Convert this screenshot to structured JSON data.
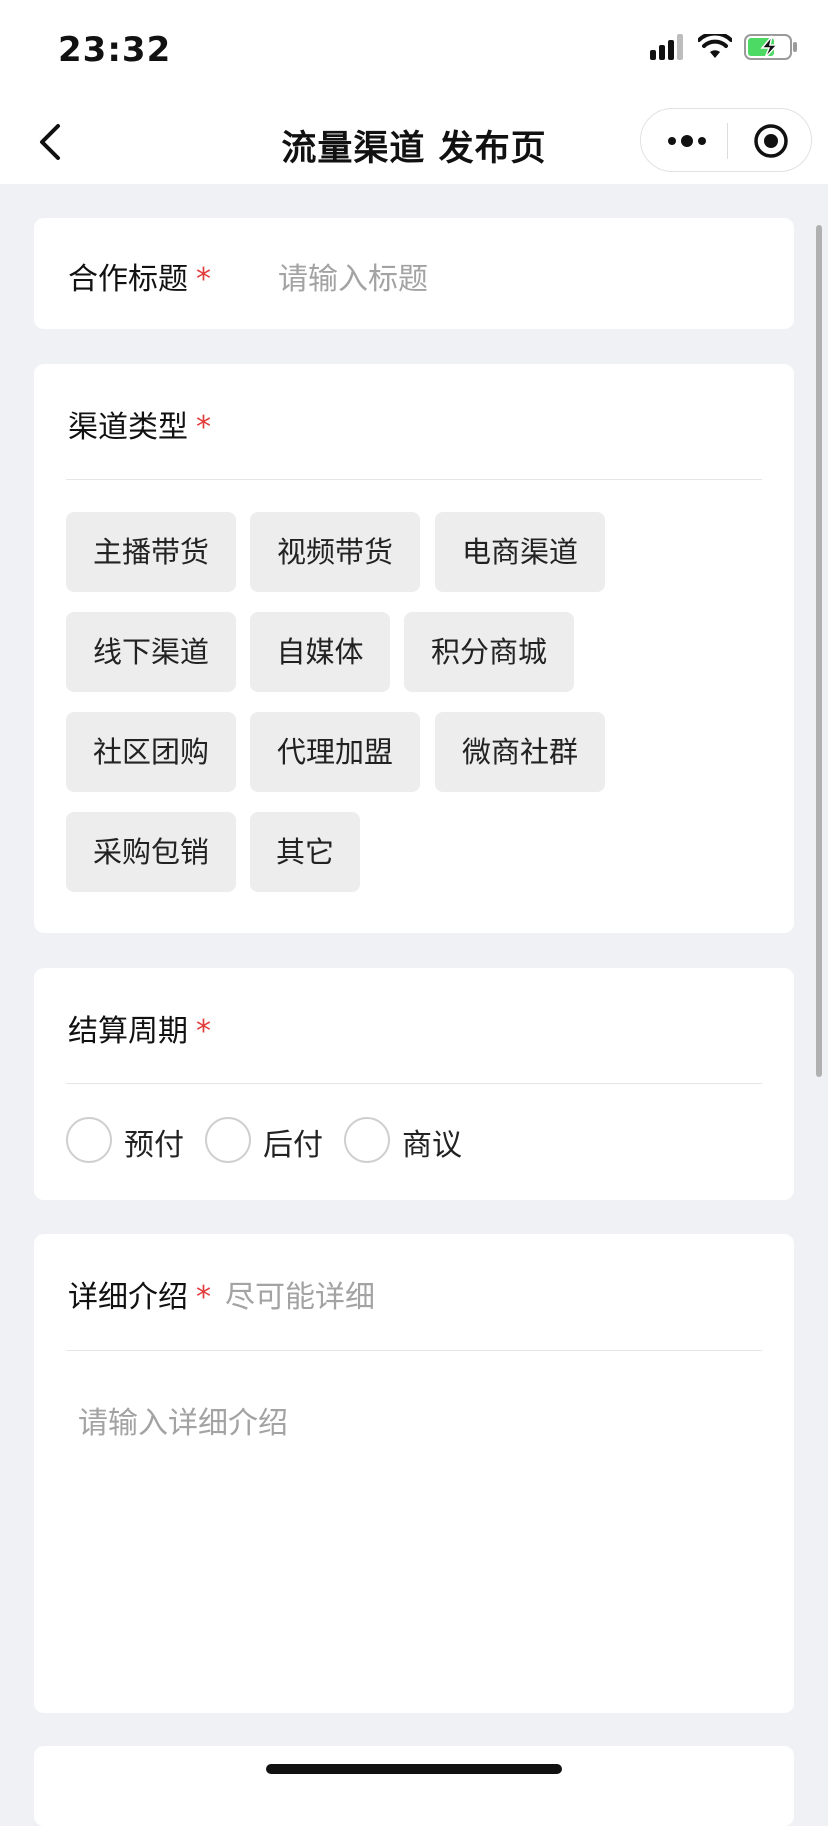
{
  "status": {
    "time": "23:32"
  },
  "nav": {
    "title": "流量渠道 发布页"
  },
  "form": {
    "required_mark": "*",
    "title_field": {
      "label": "合作标题",
      "placeholder": "请输入标题"
    },
    "channel_type": {
      "label": "渠道类型",
      "options": [
        "主播带货",
        "视频带货",
        "电商渠道",
        "线下渠道",
        "自媒体",
        "积分商城",
        "社区团购",
        "代理加盟",
        "微商社群",
        "采购包销",
        "其它"
      ]
    },
    "settlement": {
      "label": "结算周期",
      "options": [
        "预付",
        "后付",
        "商议"
      ]
    },
    "detail": {
      "label": "详细介绍",
      "hint": "尽可能详细",
      "placeholder": "请输入详细介绍"
    }
  }
}
